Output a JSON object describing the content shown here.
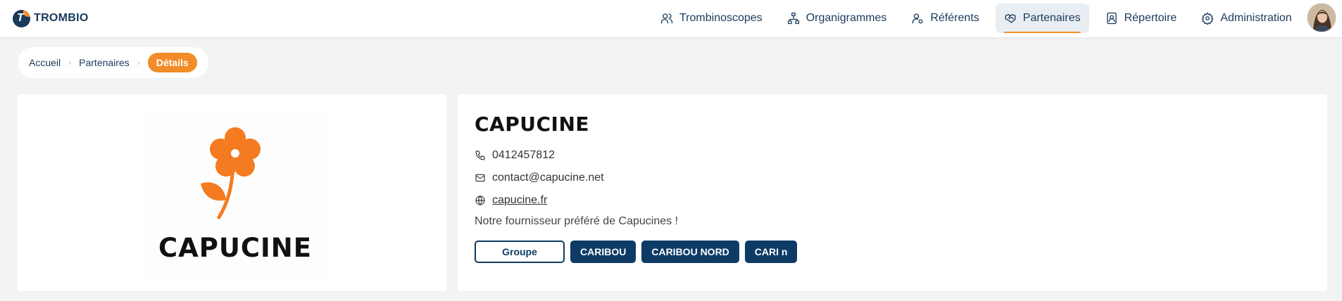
{
  "brand": {
    "logo_letter": "T",
    "name": "TROMBIO"
  },
  "nav": {
    "items": [
      {
        "label": "Trombinoscopes",
        "icon": "users-icon"
      },
      {
        "label": "Organigrammes",
        "icon": "org-chart-icon"
      },
      {
        "label": "Référents",
        "icon": "user-settings-icon"
      },
      {
        "label": "Partenaires",
        "icon": "handshake-icon",
        "active": true
      },
      {
        "label": "Répertoire",
        "icon": "contact-book-icon"
      },
      {
        "label": "Administration",
        "icon": "gear-icon"
      }
    ],
    "accent": "#f28c28",
    "text_color": "#1a3a5c"
  },
  "breadcrumb": {
    "items": [
      "Accueil",
      "Partenaires"
    ],
    "current": "Détails",
    "separator": "›"
  },
  "partner": {
    "logo_text": "CAPUCINE",
    "name": "CAPUCINE",
    "phone": "0412457812",
    "email": "contact@capucine.net",
    "website": "capucine.fr",
    "description": "Notre fournisseur préféré de Capucines !",
    "tags": [
      {
        "label": "Groupe",
        "style": "outline"
      },
      {
        "label": "CARIBOU",
        "style": "filled"
      },
      {
        "label": "CARIBOU NORD",
        "style": "filled"
      },
      {
        "label": "CARI n",
        "style": "filled"
      }
    ],
    "tag_color": "#0d3b66",
    "logo_color": "#f47b20"
  }
}
